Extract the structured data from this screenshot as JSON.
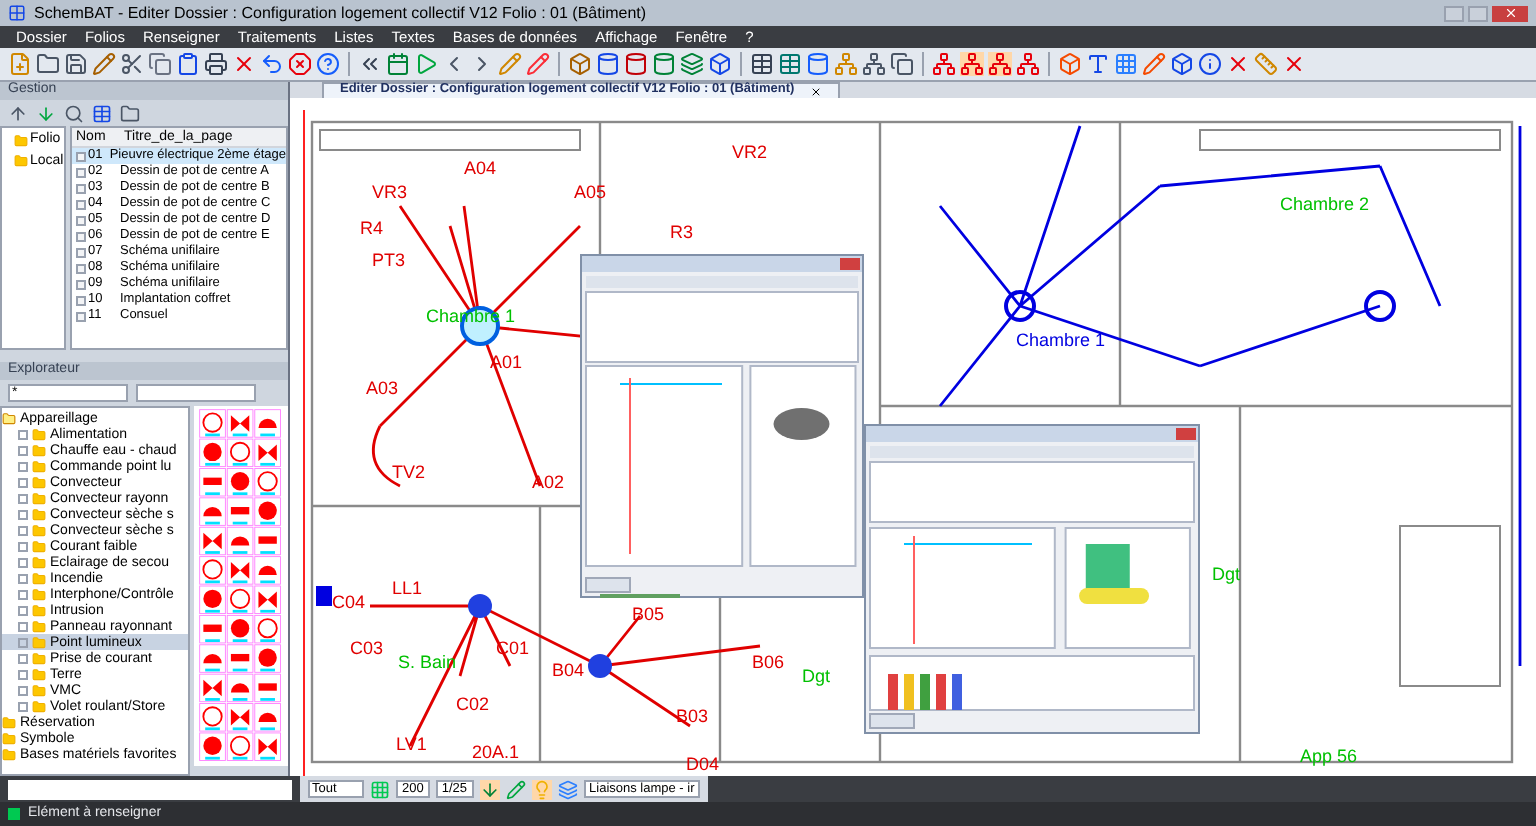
{
  "window": {
    "title": "SchemBAT - Editer  Dossier : Configuration logement collectif V12  Folio : 01  (Bâtiment)"
  },
  "menu": [
    "Dossier",
    "Folios",
    "Renseigner",
    "Traitements",
    "Listes",
    "Textes",
    "Bases de données",
    "Affichage",
    "Fenêtre",
    "?"
  ],
  "gestion": {
    "title": "Gestion",
    "tree": [
      "Folio",
      "Local"
    ],
    "columns": [
      "Nom",
      "Titre_de_la_page"
    ],
    "rows": [
      {
        "nom": "01",
        "titre": "Pieuvre électrique 2ème étage",
        "selected": true
      },
      {
        "nom": "02",
        "titre": "Dessin de pot de centre A",
        "selected": false
      },
      {
        "nom": "03",
        "titre": "Dessin de pot de centre B",
        "selected": false
      },
      {
        "nom": "04",
        "titre": "Dessin de pot de centre C",
        "selected": false
      },
      {
        "nom": "05",
        "titre": "Dessin de pot de centre D",
        "selected": false
      },
      {
        "nom": "06",
        "titre": "Dessin de pot de centre E",
        "selected": false
      },
      {
        "nom": "07",
        "titre": "Schéma unifilaire",
        "selected": false
      },
      {
        "nom": "08",
        "titre": "Schéma unifilaire",
        "selected": false
      },
      {
        "nom": "09",
        "titre": "Schéma unifilaire",
        "selected": false
      },
      {
        "nom": "10",
        "titre": "Implantation coffret",
        "selected": false
      },
      {
        "nom": "11",
        "titre": "Consuel",
        "selected": false
      }
    ]
  },
  "explorateur": {
    "title": "Explorateur",
    "filter": "*",
    "tree": [
      {
        "label": "Appareillage",
        "expanded": true,
        "children": [
          {
            "label": "Alimentation",
            "selected": false
          },
          {
            "label": "Chauffe eau - chaud",
            "selected": false
          },
          {
            "label": "Commande point lu",
            "selected": false
          },
          {
            "label": "Convecteur",
            "selected": false
          },
          {
            "label": "Convecteur rayonn",
            "selected": false
          },
          {
            "label": "Convecteur sèche s",
            "selected": false
          },
          {
            "label": "Convecteur sèche s",
            "selected": false
          },
          {
            "label": "Courant faible",
            "selected": false
          },
          {
            "label": "Eclairage de secou",
            "selected": false
          },
          {
            "label": "Incendie",
            "selected": false
          },
          {
            "label": "Interphone/Contrôle",
            "selected": false
          },
          {
            "label": "Intrusion",
            "selected": false
          },
          {
            "label": "Panneau rayonnant",
            "selected": false
          },
          {
            "label": "Point lumineux",
            "selected": true
          },
          {
            "label": "Prise de courant",
            "selected": false
          },
          {
            "label": "Terre",
            "selected": false
          },
          {
            "label": "VMC",
            "selected": false
          },
          {
            "label": "Volet roulant/Store",
            "selected": false
          }
        ]
      },
      {
        "label": "Réservation",
        "expanded": false
      },
      {
        "label": "Symbole",
        "expanded": false
      },
      {
        "label": "Bases matériels favorites",
        "expanded": false
      }
    ]
  },
  "document_tab": {
    "title": "Editer  Dossier : Configuration logement collectif V12  Folio : 01  (Bâtiment)"
  },
  "drawing": {
    "labels": [
      {
        "text": "VR2",
        "color": "#e00000"
      },
      {
        "text": "A04",
        "color": "#e00000"
      },
      {
        "text": "VR3",
        "color": "#e00000"
      },
      {
        "text": "A05",
        "color": "#e00000"
      },
      {
        "text": "R4",
        "color": "#e00000"
      },
      {
        "text": "R3",
        "color": "#e00000"
      },
      {
        "text": "PT3",
        "color": "#e00000"
      },
      {
        "text": "Chambre 1",
        "color": "#00c000"
      },
      {
        "text": "A01",
        "color": "#e00000"
      },
      {
        "text": "A03",
        "color": "#e00000"
      },
      {
        "text": "TV2",
        "color": "#e00000"
      },
      {
        "text": "A02",
        "color": "#e00000"
      },
      {
        "text": "C04",
        "color": "#e00000"
      },
      {
        "text": "LL1",
        "color": "#e00000"
      },
      {
        "text": "C03",
        "color": "#e00000"
      },
      {
        "text": "S. Bain",
        "color": "#00c000"
      },
      {
        "text": "C02",
        "color": "#e00000"
      },
      {
        "text": "C01",
        "color": "#e00000"
      },
      {
        "text": "LV1",
        "color": "#e00000"
      },
      {
        "text": "20A.1",
        "color": "#e00000"
      },
      {
        "text": "B04",
        "color": "#e00000"
      },
      {
        "text": "B05",
        "color": "#e00000"
      },
      {
        "text": "B06",
        "color": "#e00000"
      },
      {
        "text": "B03",
        "color": "#e00000"
      },
      {
        "text": "D04",
        "color": "#e00000"
      },
      {
        "text": "Dgt",
        "color": "#00c000"
      },
      {
        "text": "Chambre 1",
        "color": "#0000e0"
      },
      {
        "text": "Chambre 2",
        "color": "#00c000"
      },
      {
        "text": "Dgt",
        "color": "#00c000"
      },
      {
        "text": "App 56",
        "color": "#00c000"
      }
    ]
  },
  "bottom_toolbar": {
    "filter": "Tout",
    "scale": "200",
    "ratio": "1/25",
    "layer": "Liaisons lampe - ir"
  },
  "status_bar": {
    "text": "Elément à renseigner"
  }
}
